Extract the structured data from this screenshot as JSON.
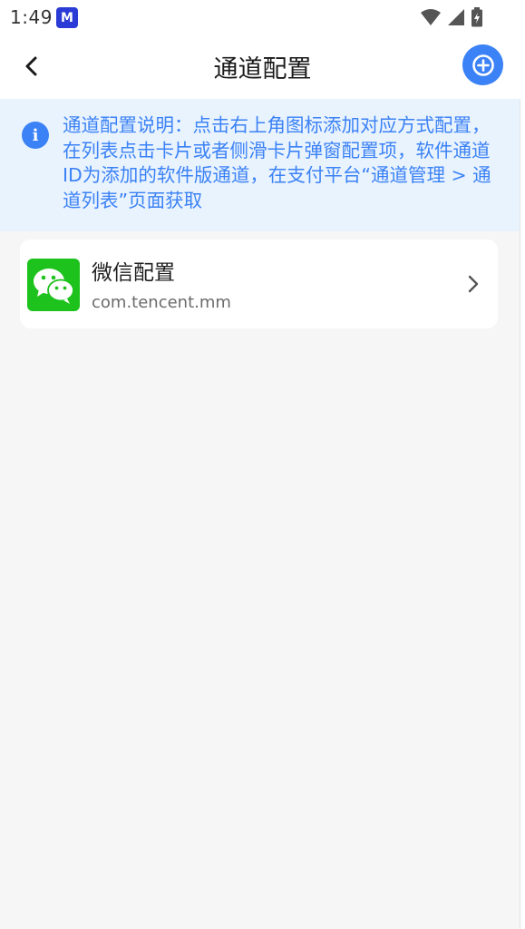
{
  "status_bar": {
    "time": "1:49",
    "app_badge": "M",
    "icons": [
      "wifi-icon",
      "signal-icon",
      "battery-icon"
    ]
  },
  "header": {
    "title": "通道配置",
    "back_icon": "chevron-left-icon",
    "add_icon": "plus-circle-icon"
  },
  "info": {
    "icon": "info-icon",
    "text": "通道配置说明：点击右上角图标添加对应方式配置，在列表点击卡片或者侧滑卡片弹窗配置项，软件通道ID为添加的软件版通道，在支付平台“通道管理 > 通道列表”页面获取"
  },
  "channels": [
    {
      "name": "微信配置",
      "package": "com.tencent.mm",
      "icon": "wechat-icon"
    }
  ],
  "colors": {
    "accent": "#3b82f6",
    "banner_bg": "#e9f3fe",
    "page_bg": "#f6f6f6",
    "wechat_green": "#1dc21d"
  }
}
